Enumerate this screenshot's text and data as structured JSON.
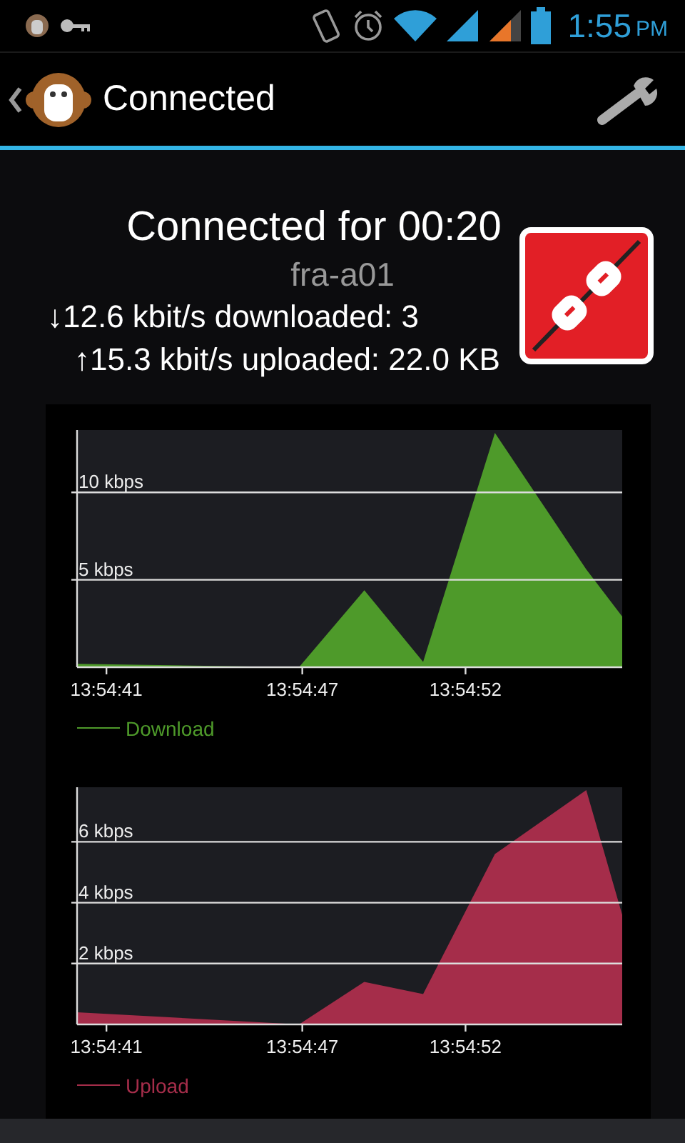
{
  "status_bar": {
    "time": "1:55",
    "period": "PM"
  },
  "action_bar": {
    "title": "Connected"
  },
  "connection": {
    "duration": "Connected for 00:20",
    "server": "fra-a01",
    "download": "↓12.6 kbit/s downloaded: 3",
    "upload": "↑15.3 kbit/s uploaded: 22.0 KB"
  },
  "charts": [
    {
      "chart_data": {
        "type": "area",
        "x": [
          50080.1,
          50086.9,
          50088.9,
          50090.7,
          50092.9,
          50095.7,
          50096.8
        ],
        "series": [
          {
            "name": "Download",
            "color": "#4e9a2a",
            "values": [
              0.2,
              0,
              4.4,
              0.3,
              13.4,
              5.6,
              2.9
            ]
          }
        ],
        "xlim": [
          50080.1,
          50096.8
        ],
        "ylim": [
          0,
          13.4
        ],
        "xticks": [
          {
            "value": 50081,
            "label": "13:54:41"
          },
          {
            "value": 50087,
            "label": "13:54:47"
          },
          {
            "value": 50092,
            "label": "13:54:52"
          }
        ],
        "yticks": [
          {
            "value": 5,
            "label": "5 kbps"
          },
          {
            "value": 10,
            "label": "10 kbps"
          }
        ],
        "grid": true
      }
    },
    {
      "chart_data": {
        "type": "area",
        "x": [
          50080.1,
          50086.9,
          50088.9,
          50090.7,
          50092.9,
          50095.7,
          50096.8
        ],
        "series": [
          {
            "name": "Upload",
            "color": "#a52d4a",
            "values": [
              0.4,
              0,
              1.4,
              1.0,
              5.6,
              7.7,
              3.6
            ]
          }
        ],
        "xlim": [
          50080.1,
          50096.8
        ],
        "ylim": [
          0,
          7.7
        ],
        "xticks": [
          {
            "value": 50081,
            "label": "13:54:41"
          },
          {
            "value": 50087,
            "label": "13:54:47"
          },
          {
            "value": 50092,
            "label": "13:54:52"
          }
        ],
        "yticks": [
          {
            "value": 2,
            "label": "2 kbps"
          },
          {
            "value": 4,
            "label": "4 kbps"
          },
          {
            "value": 6,
            "label": "6 kbps"
          }
        ],
        "grid": true
      }
    }
  ]
}
